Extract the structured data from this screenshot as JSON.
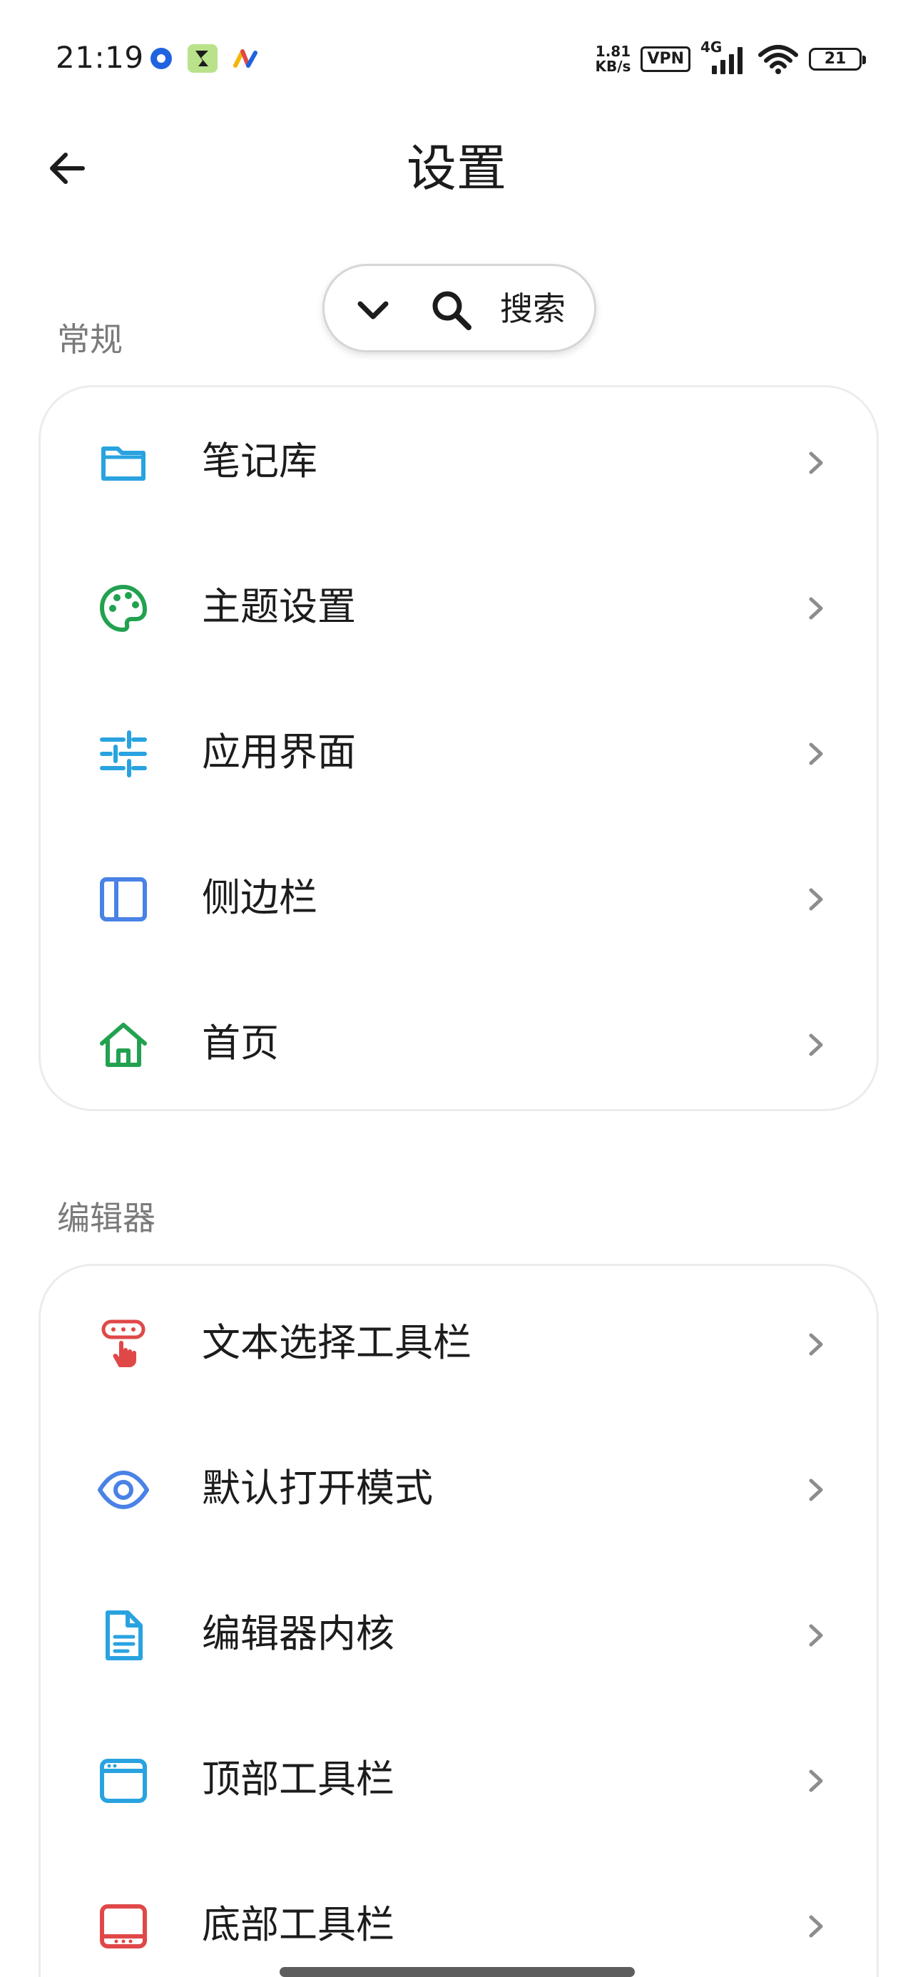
{
  "status_bar": {
    "time": "21:19",
    "net_speed_value": "1.81",
    "net_speed_unit": "KB/s",
    "vpn": "VPN",
    "network": "4G",
    "battery": "21"
  },
  "header": {
    "title": "设置",
    "back_icon": "arrow-left-icon"
  },
  "search": {
    "label": "搜索",
    "icons": [
      "chevron-down-icon",
      "search-icon"
    ]
  },
  "sections": [
    {
      "label": "常规",
      "items": [
        {
          "label": "笔记库",
          "icon": "folder-icon",
          "color": "#29a3e0"
        },
        {
          "label": "主题设置",
          "icon": "palette-icon",
          "color": "#22a150"
        },
        {
          "label": "应用界面",
          "icon": "sliders-icon",
          "color": "#29a3e0"
        },
        {
          "label": "侧边栏",
          "icon": "sidebar-icon",
          "color": "#4a82e6"
        },
        {
          "label": "首页",
          "icon": "home-icon",
          "color": "#22a150"
        }
      ]
    },
    {
      "label": "编辑器",
      "items": [
        {
          "label": "文本选择工具栏",
          "icon": "touch-toolbar-icon",
          "color": "#e04848"
        },
        {
          "label": "默认打开模式",
          "icon": "eye-icon",
          "color": "#4a82e6"
        },
        {
          "label": "编辑器内核",
          "icon": "document-icon",
          "color": "#29a3e0"
        },
        {
          "label": "顶部工具栏",
          "icon": "window-top-icon",
          "color": "#29a3e0"
        },
        {
          "label": "底部工具栏",
          "icon": "window-bottom-icon",
          "color": "#e04848"
        }
      ]
    }
  ],
  "colors": {
    "chevron": "#8d8d8d",
    "section_label": "#7a7a7a",
    "card_border": "#ececec"
  }
}
